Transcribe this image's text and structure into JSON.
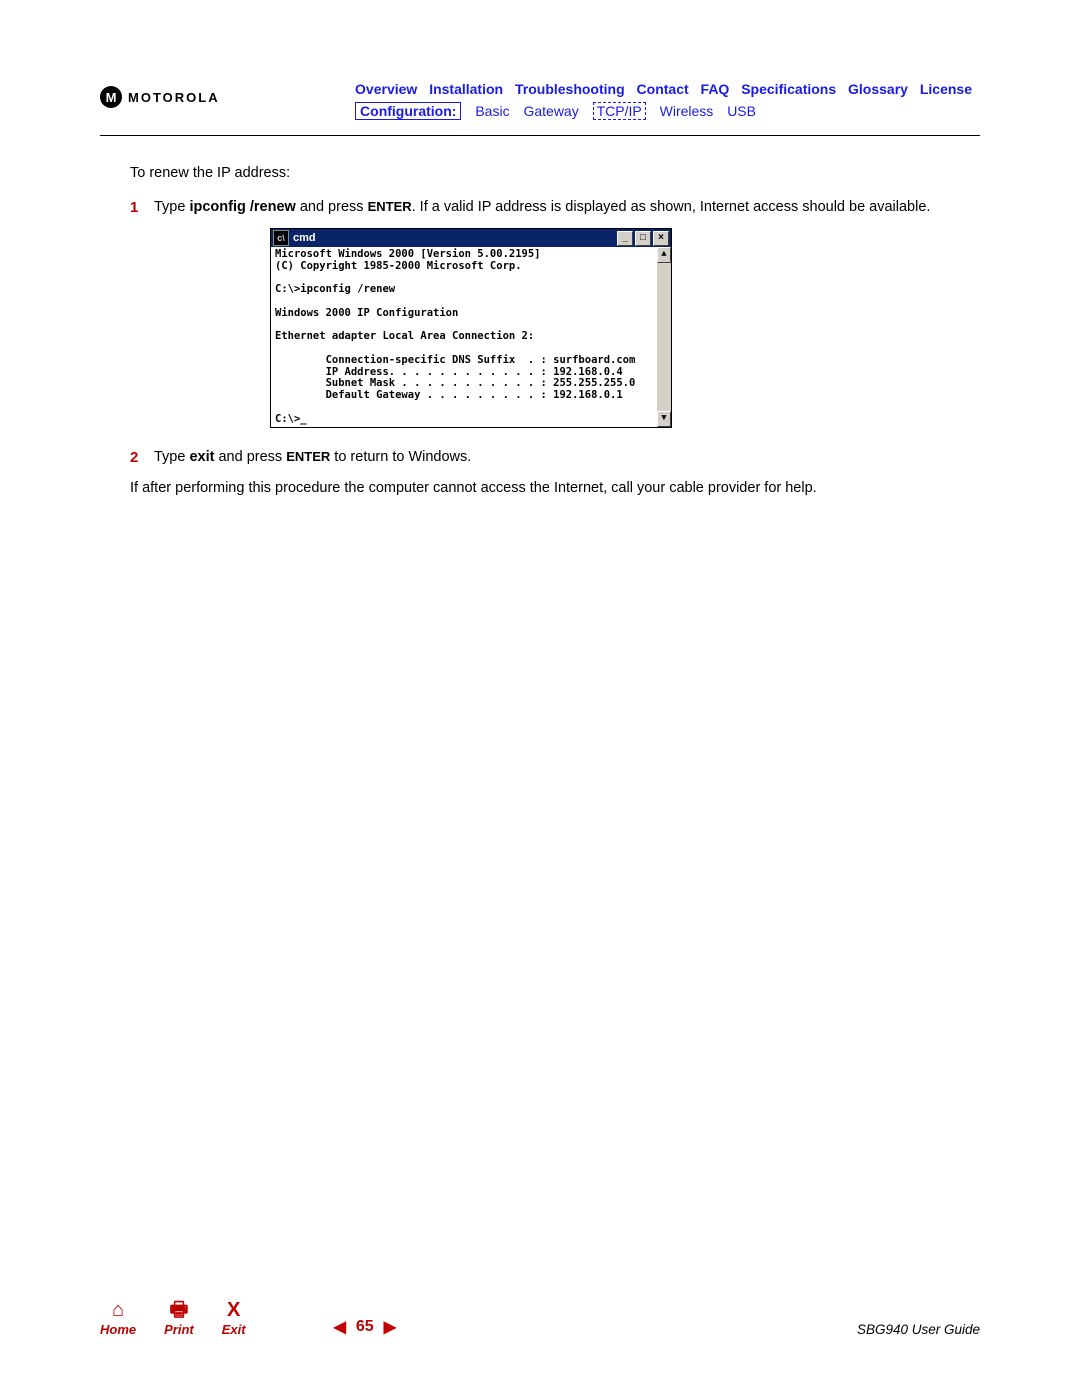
{
  "brand": "MOTOROLA",
  "nav_top": [
    "Overview",
    "Installation",
    "Troubleshooting",
    "Contact",
    "FAQ",
    "Specifications",
    "Glossary",
    "License"
  ],
  "nav_bottom": {
    "current": "Configuration:",
    "items": [
      "Basic",
      "Gateway",
      "TCP/IP",
      "Wireless",
      "USB"
    ],
    "dashed_index": 2
  },
  "intro": "To renew the IP address:",
  "step1": {
    "num": "1",
    "pre": "Type ",
    "cmd": "ipconfig /renew",
    "mid": " and press ",
    "key": "ENTER",
    "post": ". If a valid IP address is displayed as shown, Internet access should be available."
  },
  "cmd": {
    "title": "cmd",
    "lines": "Microsoft Windows 2000 [Version 5.00.2195]\n(C) Copyright 1985-2000 Microsoft Corp.\n\nC:\\>ipconfig /renew\n\nWindows 2000 IP Configuration\n\nEthernet adapter Local Area Connection 2:\n\n        Connection-specific DNS Suffix  . : surfboard.com\n        IP Address. . . . . . . . . . . . : 192.168.0.4\n        Subnet Mask . . . . . . . . . . . : 255.255.255.0\n        Default Gateway . . . . . . . . . : 192.168.0.1\n\nC:\\>_"
  },
  "step2": {
    "num": "2",
    "pre": "Type ",
    "cmd": "exit",
    "mid": " and press ",
    "key": "ENTER",
    "post": " to return to Windows."
  },
  "closing": "If after performing this procedure the computer cannot access the Internet, call your cable provider for help.",
  "footer": {
    "home": "Home",
    "print": "Print",
    "exit": "Exit",
    "page": "65",
    "guide": "SBG940 User Guide"
  }
}
